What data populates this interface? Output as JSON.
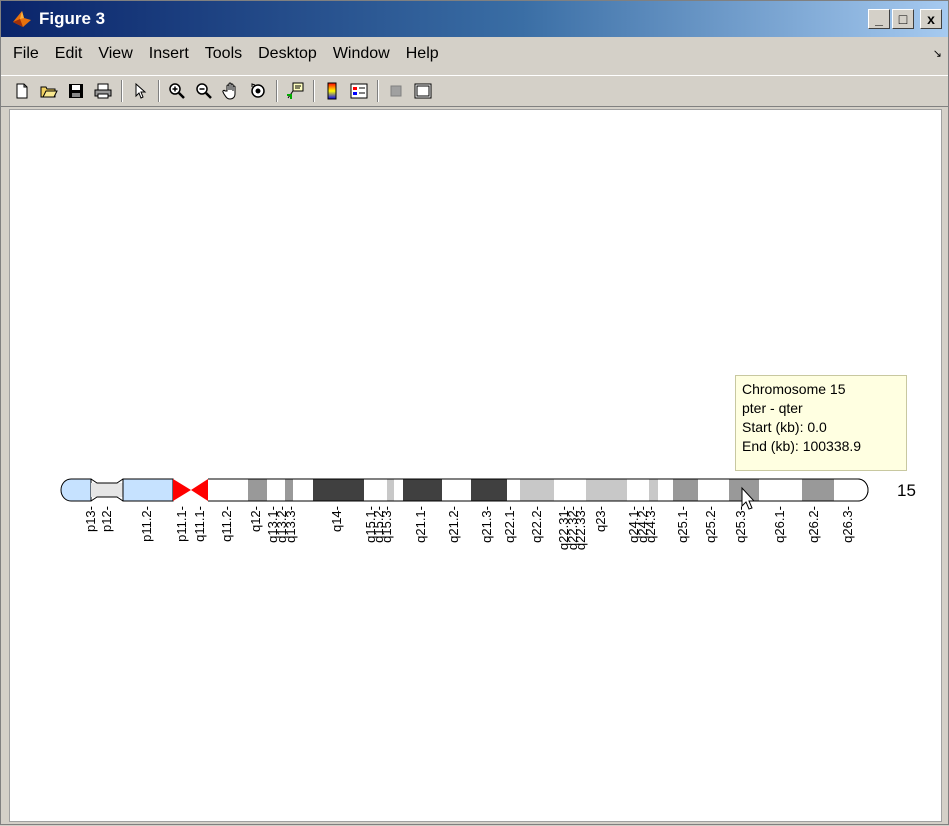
{
  "window": {
    "title": "Figure 3",
    "buttons": [
      "_",
      "□",
      "x"
    ]
  },
  "menu": [
    "File",
    "Edit",
    "View",
    "Insert",
    "Tools",
    "Desktop",
    "Window",
    "Help"
  ],
  "menu_overflow": "↘",
  "toolbar_icons": [
    "new-figure-icon",
    "open-file-icon",
    "save-icon",
    "print-icon",
    "edit-plot-arrow-icon",
    "zoom-in-icon",
    "zoom-out-icon",
    "pan-hand-icon",
    "rotate-3d-icon",
    "data-cursor-icon",
    "colorbar-icon",
    "legend-icon",
    "hide-plot-tools-icon",
    "show-plot-tools-icon"
  ],
  "tooltip": {
    "line1": "Chromosome 15",
    "line2": "pter - qter",
    "line3": "Start (kb): 0.0",
    "line4": "End (kb): 100338.9"
  },
  "chromosome_label": "15",
  "band_labels": [
    "p13",
    "p12",
    "p11.2",
    "p11.1",
    "q11.1",
    "q11.2",
    "q12",
    "q13.1",
    "q13.2",
    "q13.3",
    "q14",
    "q15.1",
    "q15.2",
    "q15.3",
    "q21.1",
    "q21.2",
    "q21.3",
    "q22.1",
    "q22.2",
    "q22.31",
    "q22.32",
    "q22.33",
    "q23",
    "q24.1",
    "q24.2",
    "q24.3",
    "q25.1",
    "q25.2",
    "q25.3",
    "q26.1",
    "q26.2",
    "q26.3"
  ],
  "colors": {
    "centromere": "#ff0000",
    "stalk": "#e6e6e6",
    "p_arm_blue": "#c6e2ff",
    "gneg": "#ffffff",
    "gpos25": "#c8c8c8",
    "gpos50": "#999999",
    "gpos75": "#666666",
    "gpos100": "#404040"
  }
}
